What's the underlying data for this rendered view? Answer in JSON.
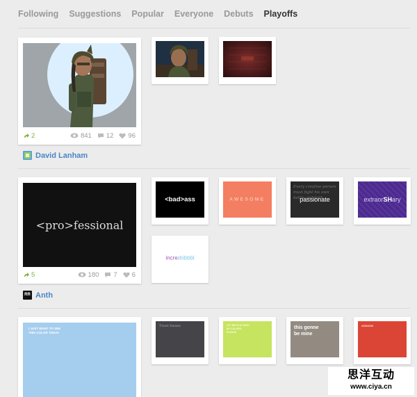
{
  "tabs": [
    {
      "label": "Following",
      "active": false
    },
    {
      "label": "Suggestions",
      "active": false
    },
    {
      "label": "Popular",
      "active": false
    },
    {
      "label": "Everyone",
      "active": false
    },
    {
      "label": "Debuts",
      "active": false
    },
    {
      "label": "Playoffs",
      "active": true
    }
  ],
  "groups": [
    {
      "main": {
        "rebounds": "2",
        "views": "841",
        "comments": "12",
        "likes": "96"
      },
      "author": "David Lanham",
      "thumbs": []
    },
    {
      "main": {
        "title": "<pro>fessional",
        "rebounds": "5",
        "views": "180",
        "comments": "7",
        "likes": "6"
      },
      "author": "Anth",
      "avatar_text": "RR",
      "thumbs": [
        {
          "text": "<bad>ass"
        },
        {
          "text": "AWESOME"
        },
        {
          "text": "passionate",
          "script_text": "Every creative person must fight his own battle and faith"
        },
        {
          "text_pre": "extraor",
          "text_bold": "SH",
          "text_post": "ary"
        },
        {
          "text_pre": "incre",
          "text_post": "dribbbl"
        }
      ]
    },
    {
      "main": {
        "caption": "I JUST WANT TO SEE THIS COLOR TODAY"
      },
      "thumbs": [
        {
          "text": "Trust Issues"
        },
        {
          "text": "LET ME PLAY WITH MY COLORS, PLEASE"
        },
        {
          "text": "this gonne be mine"
        },
        {
          "text": "#DB4535"
        }
      ]
    }
  ],
  "watermark": {
    "cn": "思洋互动",
    "url": "www.ciya.cn"
  },
  "colors": {
    "accent_link": "#4a85c8",
    "rebound_green": "#7db23a",
    "salmon": "#f47e61",
    "lime": "#c6e45f",
    "taupe": "#938b82",
    "red": "#db4535",
    "sky": "#a5cdee",
    "charcoal": "#444449"
  }
}
